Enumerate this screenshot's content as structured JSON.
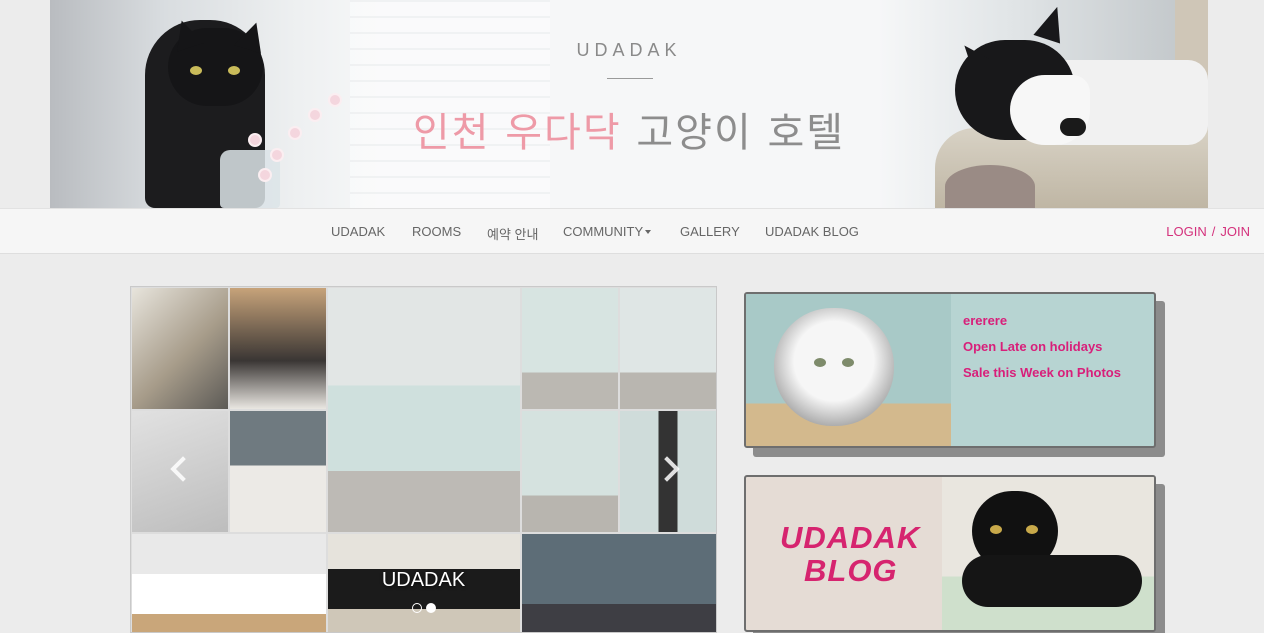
{
  "banner": {
    "brand": "UDADAK",
    "title_pink": "인천 우다닥",
    "title_gray": "고양이 호텔"
  },
  "nav": {
    "items": [
      {
        "label": "UDADAK"
      },
      {
        "label": "ROOMS"
      },
      {
        "label": "예약 안내"
      },
      {
        "label": "COMMUNITY"
      },
      {
        "label": "GALLERY"
      },
      {
        "label": "UDADAK BLOG"
      }
    ],
    "login": "LOGIN",
    "separator": "/",
    "join": "JOIN"
  },
  "carousel": {
    "caption": "UDADAK",
    "slide_count": 2,
    "active_slide": 2
  },
  "news": {
    "links": [
      "ererere",
      "Open Late on holidays",
      "Sale this Week on Photos"
    ]
  },
  "blog_card": {
    "line1": "UDADAK",
    "line2": "BLOG"
  },
  "colors": {
    "accent": "#d4317c",
    "news_bg": "#b7d4d2",
    "blog_bg": "#e5dcd5",
    "title_pink": "#ee9aa7"
  }
}
